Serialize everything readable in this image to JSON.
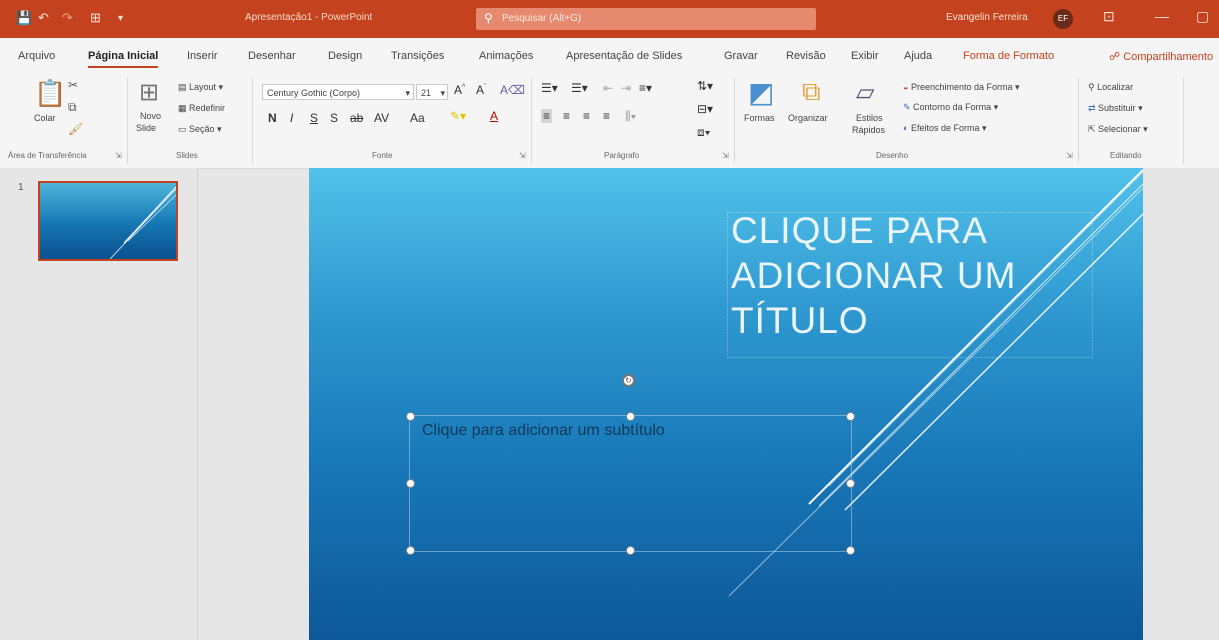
{
  "titlebar": {
    "quick_access": [
      "💾",
      "↶",
      "↷",
      "⊞",
      "▾"
    ],
    "doc_title": "Apresentação1 - PowerPoint",
    "search_placeholder": "Pesquisar (Alt+G)",
    "user_name": "Evangelin Ferreira",
    "user_initials": "EF"
  },
  "tabs": [
    "Arquivo",
    "Página Inicial",
    "Inserir",
    "Desenhar",
    "Design",
    "Transições",
    "Animações",
    "Apresentação de Slides",
    "Gravar",
    "Revisão",
    "Exibir",
    "Ajuda",
    "Forma de Formato"
  ],
  "share_label": "Compartilhamento",
  "ribbon": {
    "clipboard": {
      "paste": "Colar",
      "group": "Área de Transferência"
    },
    "slides": {
      "new_slide": "Novo",
      "new_slide2": "Slide",
      "layout": "Layout",
      "reset": "Redefinir",
      "section": "Seção",
      "group": "Slides"
    },
    "font": {
      "font_name": "Century Gothic (Corpo)",
      "font_size": "21",
      "group": "Fonte",
      "format_buttons": [
        "N",
        "I",
        "S",
        "S",
        "ab",
        "AV",
        "Aa",
        "A"
      ]
    },
    "paragraph": {
      "group": "Parágrafo"
    },
    "drawing": {
      "shapes": "Formas",
      "arrange": "Organizar",
      "quick_styles": "Estilos",
      "quick_styles2": "Rápidos",
      "fill": "Preenchimento da Forma",
      "outline": "Contorno da Forma",
      "effects": "Efeitos de Forma",
      "group": "Desenho"
    },
    "editing": {
      "find": "Localizar",
      "replace": "Substituir",
      "select": "Selecionar",
      "group": "Editando"
    }
  },
  "slides_pane": {
    "slide_number": "1"
  },
  "slide": {
    "title_lines": [
      "CLIQUE PARA",
      "ADICIONAR UM",
      "TÍTULO"
    ],
    "subtitle_placeholder": "Clique para adicionar um subtítulo"
  }
}
